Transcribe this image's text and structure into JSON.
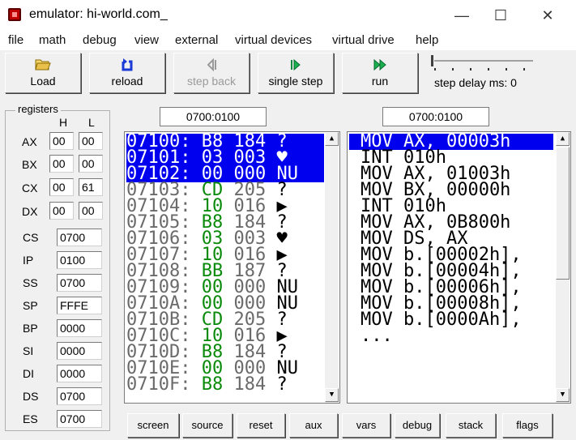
{
  "window": {
    "title": "emulator: hi-world.com_",
    "minimize": "—",
    "maximize": "☐",
    "close": "✕"
  },
  "menu": [
    "file",
    "math",
    "debug",
    "view",
    "external",
    "virtual devices",
    "virtual drive",
    "help"
  ],
  "toolbar": {
    "load": "Load",
    "reload": "reload",
    "step_back": "step back",
    "single_step": "single step",
    "run": "run",
    "step_delay": "step delay ms: 0",
    "icons": {
      "load": "folder-open-icon",
      "reload": "reload-icon",
      "step_back": "step-back-icon",
      "single_step": "single-step-icon",
      "run": "run-icon"
    }
  },
  "registers": {
    "legend": "registers",
    "h": "H",
    "l": "L",
    "pairs": [
      {
        "name": "AX",
        "h": "00",
        "l": "00"
      },
      {
        "name": "BX",
        "h": "00",
        "l": "00"
      },
      {
        "name": "CX",
        "h": "00",
        "l": "61"
      },
      {
        "name": "DX",
        "h": "00",
        "l": "00"
      }
    ],
    "singles": [
      {
        "name": "CS",
        "value": "0700"
      },
      {
        "name": "IP",
        "value": "0100"
      },
      {
        "name": "SS",
        "value": "0700"
      },
      {
        "name": "SP",
        "value": "FFFE"
      },
      {
        "name": "BP",
        "value": "0000"
      },
      {
        "name": "SI",
        "value": "0000"
      },
      {
        "name": "DI",
        "value": "0000"
      },
      {
        "name": "DS",
        "value": "0700"
      },
      {
        "name": "ES",
        "value": "0700"
      }
    ]
  },
  "memory": {
    "address": "0700:0100",
    "rows": [
      {
        "addr": "07100:",
        "hex": "B8",
        "dec": "184",
        "chr": "?"
      },
      {
        "addr": "07101:",
        "hex": "03",
        "dec": "003",
        "chr": "♥"
      },
      {
        "addr": "07102:",
        "hex": "00",
        "dec": "000",
        "chr": "NU"
      },
      {
        "addr": "07103:",
        "hex": "CD",
        "dec": "205",
        "chr": "?"
      },
      {
        "addr": "07104:",
        "hex": "10",
        "dec": "016",
        "chr": "▶"
      },
      {
        "addr": "07105:",
        "hex": "B8",
        "dec": "184",
        "chr": "?"
      },
      {
        "addr": "07106:",
        "hex": "03",
        "dec": "003",
        "chr": "♥"
      },
      {
        "addr": "07107:",
        "hex": "10",
        "dec": "016",
        "chr": "▶"
      },
      {
        "addr": "07108:",
        "hex": "BB",
        "dec": "187",
        "chr": "?"
      },
      {
        "addr": "07109:",
        "hex": "00",
        "dec": "000",
        "chr": "NU"
      },
      {
        "addr": "0710A:",
        "hex": "00",
        "dec": "000",
        "chr": "NU"
      },
      {
        "addr": "0710B:",
        "hex": "CD",
        "dec": "205",
        "chr": "?"
      },
      {
        "addr": "0710C:",
        "hex": "10",
        "dec": "016",
        "chr": "▶"
      },
      {
        "addr": "0710D:",
        "hex": "B8",
        "dec": "184",
        "chr": "?"
      },
      {
        "addr": "0710E:",
        "hex": "00",
        "dec": "000",
        "chr": "NU"
      },
      {
        "addr": "0710F:",
        "hex": "B8",
        "dec": "184",
        "chr": "?"
      }
    ],
    "selected_count": 3
  },
  "disassembly": {
    "address": "0700:0100",
    "lines": [
      "MOV AX, 00003h",
      "INT 010h",
      "MOV AX, 01003h",
      "MOV BX, 00000h",
      "INT 010h",
      "MOV AX, 0B800h",
      "MOV DS, AX",
      "MOV b.[00002h],",
      "MOV b.[00004h],",
      "MOV b.[00006h],",
      "MOV b.[00008h],",
      "MOV b.[0000Ah],",
      "..."
    ],
    "selected_index": 0
  },
  "bottom_buttons": [
    "screen",
    "source",
    "reset",
    "aux",
    "vars",
    "debug",
    "stack",
    "flags"
  ]
}
